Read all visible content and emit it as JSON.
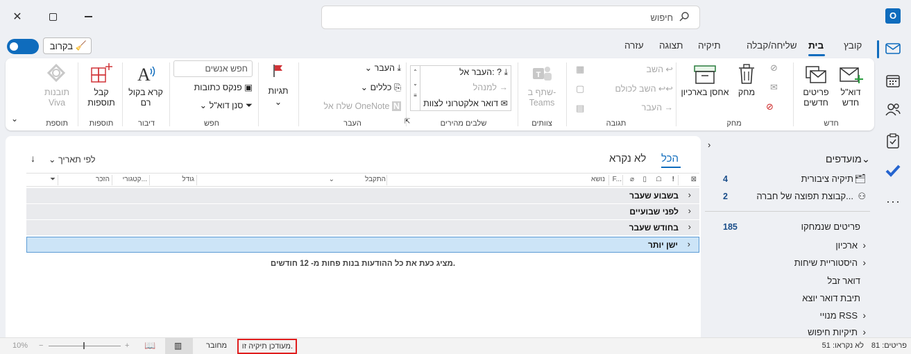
{
  "search": {
    "placeholder": "חיפוש"
  },
  "menu": {
    "tabs": [
      {
        "label": "קובץ"
      },
      {
        "label": "בית"
      },
      {
        "label": "שליחה/קבלה"
      },
      {
        "label": "תיקיה"
      },
      {
        "label": "תצוגה"
      },
      {
        "label": "עזרה"
      }
    ],
    "coming_soon": "בקרוב"
  },
  "ribbon": {
    "new": {
      "label": "חדש",
      "new_mail": "דוא\"ל חדש",
      "new_items": "פריטים חדשים"
    },
    "delete": {
      "label": "מחק",
      "delete": "מחק",
      "archive": "אחסן בארכיון"
    },
    "respond": {
      "label": "תגובה",
      "reply": "השב",
      "reply_all": "השב לכולם",
      "forward": "העבר"
    },
    "teams": {
      "label": "צוותים",
      "share": "שתף ב-Teams"
    },
    "quick_steps": {
      "label": "שלבים מהירים",
      "move_to": "העבר אל: ?",
      "to_manager": "למנהל",
      "team_email": "דואר אלקטרוני לצוות"
    },
    "move": {
      "label": "העבר",
      "move": "העבר",
      "rules": "כללים",
      "onenote": "שלח אל OneNote"
    },
    "tags": {
      "label": "תגיות"
    },
    "find": {
      "label": "חפש",
      "search_people": "חפש אנשים",
      "address_book": "פנקס כתובות",
      "filter_email": "סנן דוא\"ל"
    },
    "speech": {
      "label": "דיבור",
      "read_aloud": "קרא בקול רם"
    },
    "addins": {
      "label": "תוספות",
      "get_addins": "קבל תוספות"
    },
    "addin": {
      "label": "תוספת",
      "viva": "תובנות Viva"
    }
  },
  "folders": {
    "favorites": "מועדפים",
    "items": [
      {
        "name": "תיקיה ציבורית",
        "count": "4"
      },
      {
        "name": "קבוצת תפוצה של חברה...",
        "count": "2"
      },
      {
        "name": "פריטים שנמחקו",
        "count": "185"
      },
      {
        "name": "ארכיון",
        "count": ""
      },
      {
        "name": "היסטוריית שיחות",
        "count": ""
      },
      {
        "name": "דואר זבל",
        "count": ""
      },
      {
        "name": "תיבת דואר יוצא",
        "count": ""
      },
      {
        "name": "מנויי RSS",
        "count": ""
      },
      {
        "name": "תיקיות חיפוש",
        "count": ""
      }
    ]
  },
  "messages": {
    "tab_all": "הכל",
    "tab_unread": "לא נקרא",
    "sort_label": "לפי תאריך",
    "columns": {
      "subject": "נושא",
      "received": "התקבל",
      "size": "גודל",
      "categories": "קטגורי...",
      "mention": "הזכר",
      "from_short": "F..."
    },
    "groups": [
      {
        "label": "בשבוע שעבר"
      },
      {
        "label": "לפני שבועיים"
      },
      {
        "label": "בחודש שעבר"
      },
      {
        "label": "ישן יותר"
      }
    ],
    "info": "מציג כעת את כל ההודעות בנות פחות מ- 12 חודשים."
  },
  "status": {
    "items": "פריטים: 81",
    "unread": "לא נקראו: 51",
    "updated": "מעודכן תיקיה זו.",
    "connected": "מחובר",
    "zoom": "10%"
  },
  "colors": {
    "accent": "#0f6cbd",
    "selected_row": "#cce4f7",
    "highlight_box": "#e01e1e"
  }
}
